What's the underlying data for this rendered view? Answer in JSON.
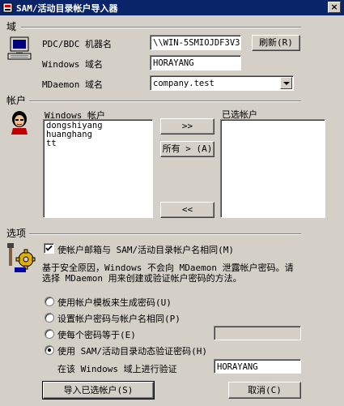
{
  "window": {
    "title": "SAM/活动目录帐户导入器",
    "close_glyph": "×"
  },
  "domain_section": {
    "heading": "域",
    "pdc_label": "PDC/BDC 机器名",
    "pdc_value": "\\\\WIN-5SMIOJDF3V3",
    "refresh_button": "刷新(R)",
    "windows_domain_label": "Windows 域名",
    "windows_domain_value": "HORAYANG",
    "mdaemon_domain_label": "MDaemon 域名",
    "mdaemon_domain_value": "company.test"
  },
  "accounts_section": {
    "heading": "帐户",
    "windows_accounts_label": "Windows 帐户",
    "windows_accounts": [
      "dongshiyang",
      "huanghang",
      "tt"
    ],
    "move_button": ">>",
    "move_all_button": "所有 > (A)",
    "remove_button": "<<",
    "selected_accounts_label": "已选帐户",
    "selected_accounts": []
  },
  "options_section": {
    "heading": "选项",
    "mailbox_same_checkbox": {
      "label": "使帐户邮箱与 SAM/活动目录帐户名相同(M)",
      "checked": true
    },
    "info_text_line1": "基于安全原因，Windows 不会向 MDaemon 泄露帐户密码。请",
    "info_text_line2": "选择 MDaemon 用来创建或验证帐户密码的方法。",
    "radio_template": {
      "label": "使用帐户模板来生成密码(U)",
      "selected": false
    },
    "radio_same_as_name": {
      "label": "设置帐户密码与帐户名相同(P)",
      "selected": false
    },
    "radio_each_password": {
      "label": "使每个密码等于(E)",
      "selected": false,
      "value": ""
    },
    "radio_dynamic_auth": {
      "label": "使用 SAM/活动目录动态验证密码(H)",
      "selected": true
    },
    "verify_domain_label": "在该 Windows 域上进行验证",
    "verify_domain_value": "HORAYANG"
  },
  "footer": {
    "import_button": "导入已选帐户(S)",
    "cancel_button": "取消(C)"
  }
}
